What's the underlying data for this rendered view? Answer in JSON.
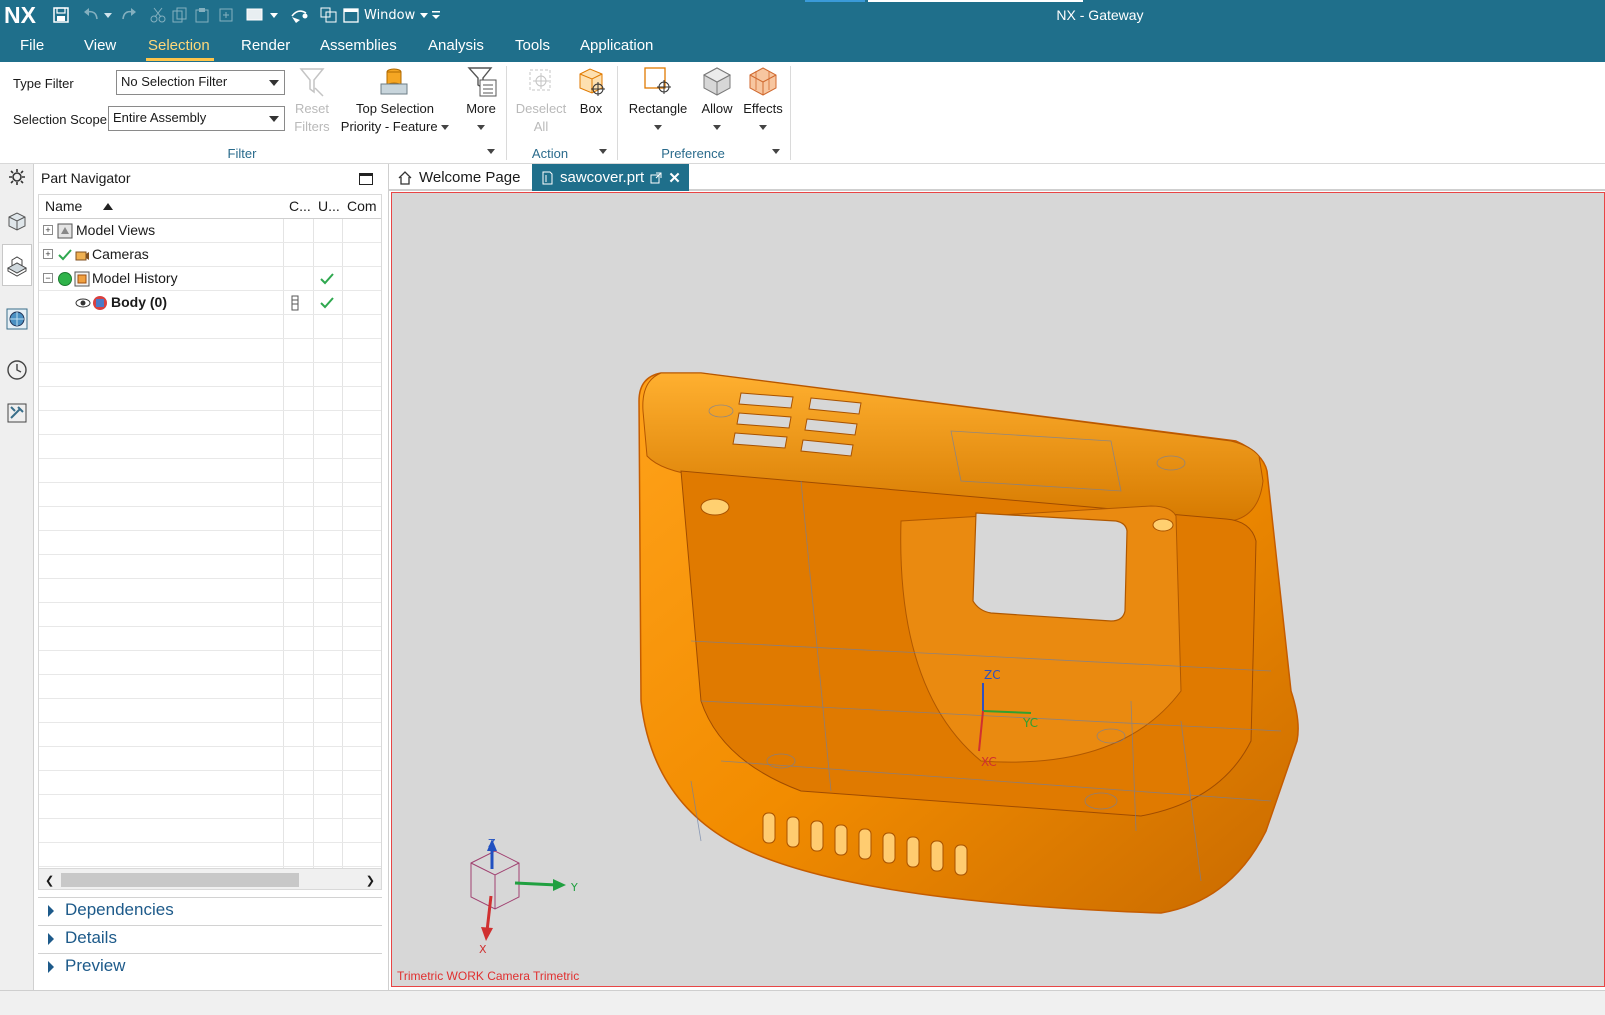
{
  "titlebar": {
    "logo": "NX",
    "window_menu": "Window",
    "app_title": "NX - Gateway"
  },
  "menu": {
    "tabs": [
      "File",
      "View",
      "Selection",
      "Render",
      "Assemblies",
      "Analysis",
      "Tools",
      "Application"
    ],
    "active": "Selection"
  },
  "ribbon": {
    "type_filter_label": "Type Filter",
    "type_filter_value": "No Selection Filter",
    "selection_scope_label": "Selection Scope",
    "selection_scope_value": "Entire Assembly",
    "reset_filters_line1": "Reset",
    "reset_filters_line2": "Filters",
    "top_selection_line1": "Top Selection",
    "top_selection_line2": "Priority - Feature",
    "more": "More",
    "deselect_all_line1": "Deselect",
    "deselect_all_line2": "All",
    "box": "Box",
    "rectangle": "Rectangle",
    "allow": "Allow",
    "effects": "Effects",
    "group_filter": "Filter",
    "group_action": "Action",
    "group_preference": "Preference"
  },
  "navigator": {
    "title": "Part Navigator",
    "columns": [
      "Name",
      "C...",
      "U...",
      "Com"
    ],
    "rows": [
      {
        "name": "Model Views",
        "bold": false,
        "up_to_date": false
      },
      {
        "name": "Cameras",
        "bold": false,
        "up_to_date": false
      },
      {
        "name": "Model History",
        "bold": false,
        "up_to_date": true
      },
      {
        "name": "Body (0)",
        "bold": true,
        "up_to_date": true
      }
    ],
    "sections": [
      "Dependencies",
      "Details",
      "Preview"
    ]
  },
  "doc_tabs": {
    "welcome": "Welcome Page",
    "active_file": "sawcover.prt"
  },
  "viewport": {
    "caption": "Trimetric WORK Camera Trimetric",
    "axis_labels": {
      "zc": "ZC",
      "yc": "YC",
      "xc": "XC",
      "z": "Z",
      "y": "Y",
      "x": "X"
    }
  },
  "colors": {
    "accent": "#1f6f8b",
    "menu_active": "#ffc54a",
    "model_orange": "#f28c00",
    "viewport_border": "#e84545"
  }
}
